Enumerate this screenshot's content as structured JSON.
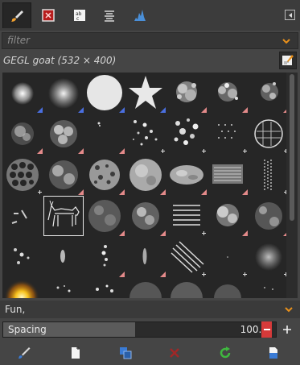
{
  "tabs": [
    {
      "icon": "paintbrush-icon",
      "active": true
    },
    {
      "icon": "pattern-icon",
      "active": false
    },
    {
      "icon": "fonts-icon",
      "active": false
    },
    {
      "icon": "document-history-icon",
      "active": false
    },
    {
      "icon": "histogram-icon",
      "active": false
    }
  ],
  "filter": {
    "label": "filter"
  },
  "brush": {
    "title": "GEGL goat (532 × 400)"
  },
  "tag_selector": {
    "value": "Fun,"
  },
  "spacing": {
    "label": "Spacing",
    "value": "100.0",
    "fraction": 0.485
  },
  "colors": {
    "accent": "#e8901b",
    "red": "#d63a3a",
    "green": "#3fb83f",
    "blue": "#3a7bd5",
    "pink_mark": "#e48a8a",
    "blue_mark": "#4a6fe0"
  }
}
